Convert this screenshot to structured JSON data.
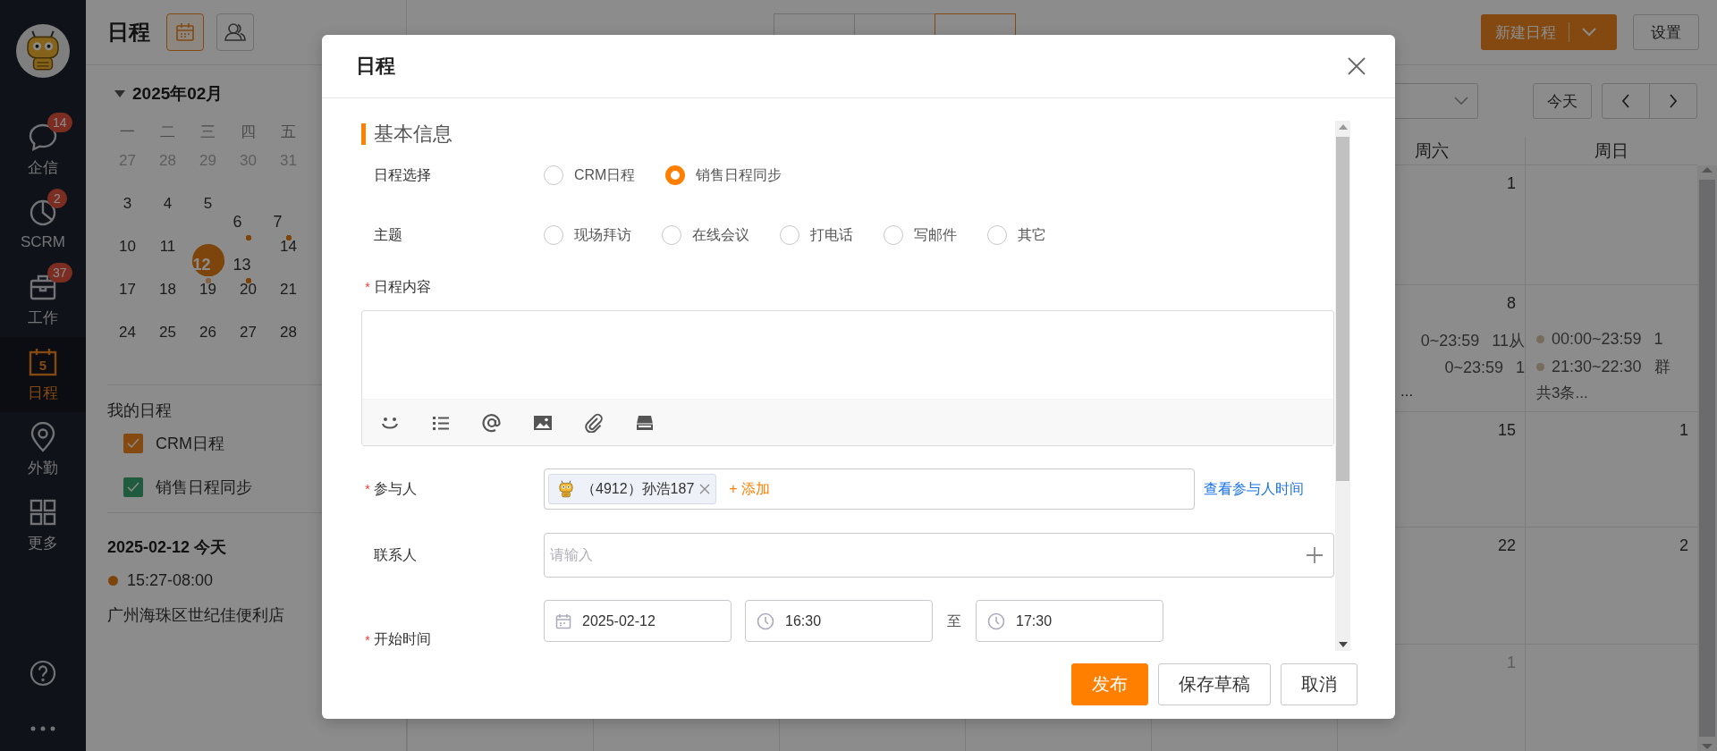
{
  "nav": {
    "items": [
      {
        "label": "企信",
        "badge": "14",
        "selected": false
      },
      {
        "label": "SCRM",
        "badge": "2",
        "selected": false
      },
      {
        "label": "工作",
        "badge": "37",
        "selected": false
      },
      {
        "label": "日程",
        "icon_text": "5",
        "selected": true
      },
      {
        "label": "外勤",
        "selected": false
      },
      {
        "label": "更多",
        "selected": false
      }
    ]
  },
  "panel": {
    "title": "日程",
    "view_buttons": [
      {
        "selected": true
      },
      {
        "selected": false
      }
    ]
  },
  "mini_calendar": {
    "month": "2025年02月",
    "expanded": true,
    "weekdays": [
      "一",
      "二",
      "三",
      "四",
      "五"
    ],
    "weeks": [
      [
        {
          "day": "27",
          "muted": true,
          "selected": false,
          "has_event": false
        },
        {
          "day": "28",
          "muted": true,
          "selected": false,
          "has_event": false
        },
        {
          "day": "29",
          "muted": true,
          "selected": false,
          "has_event": false
        },
        {
          "day": "30",
          "muted": true,
          "selected": false,
          "has_event": false
        },
        {
          "day": "31",
          "muted": true,
          "selected": false,
          "has_event": false
        }
      ],
      [
        {
          "day": "3",
          "muted": false,
          "selected": false,
          "has_event": false
        },
        {
          "day": "4",
          "muted": false,
          "selected": false,
          "has_event": false
        },
        {
          "day": "5",
          "muted": false,
          "selected": false,
          "has_event": false
        },
        {
          "day": "6",
          "muted": false,
          "selected": false,
          "has_event": true
        },
        {
          "day": "7",
          "muted": false,
          "selected": false,
          "has_event": true
        }
      ],
      [
        {
          "day": "10",
          "muted": false,
          "selected": false,
          "has_event": false
        },
        {
          "day": "11",
          "muted": false,
          "selected": false,
          "has_event": false
        },
        {
          "day": "12",
          "muted": false,
          "selected": true,
          "has_event": true
        },
        {
          "day": "13",
          "muted": false,
          "selected": false,
          "has_event": true
        },
        {
          "day": "14",
          "muted": false,
          "selected": false,
          "has_event": false
        }
      ],
      [
        {
          "day": "17",
          "muted": false,
          "selected": false,
          "has_event": false
        },
        {
          "day": "18",
          "muted": false,
          "selected": false,
          "has_event": false
        },
        {
          "day": "19",
          "muted": false,
          "selected": false,
          "has_event": false
        },
        {
          "day": "20",
          "muted": false,
          "selected": false,
          "has_event": false
        },
        {
          "day": "21",
          "muted": false,
          "selected": false,
          "has_event": false
        }
      ],
      [
        {
          "day": "24",
          "muted": false,
          "selected": false,
          "has_event": false
        },
        {
          "day": "25",
          "muted": false,
          "selected": false,
          "has_event": false
        },
        {
          "day": "26",
          "muted": false,
          "selected": false,
          "has_event": false
        },
        {
          "day": "27",
          "muted": false,
          "selected": false,
          "has_event": false
        },
        {
          "day": "28",
          "muted": false,
          "selected": false,
          "has_event": false
        }
      ]
    ]
  },
  "my_calendars": {
    "title": "我的日程",
    "items": [
      {
        "label": "CRM日程",
        "checked": true,
        "color": "#844a11"
      },
      {
        "label": "销售日程同步",
        "checked": true,
        "color": "#205c3c"
      }
    ]
  },
  "today": {
    "heading": "2025-02-12 今天",
    "events": [
      {
        "time": "15:27-08:00",
        "title": "广州海珠区世纪佳便利店"
      }
    ]
  },
  "toolbar": {
    "view_tabs": [
      {
        "selected": false
      },
      {
        "selected": false
      },
      {
        "selected": true
      }
    ],
    "new_button": "新建日程",
    "settings_button": "设置",
    "today_button": "今天"
  },
  "calendar": {
    "weekdays": [
      "周六",
      "周日"
    ],
    "weeks": [
      {
        "saturday": {
          "date": "1",
          "muted": false
        }
      },
      {
        "saturday": {
          "date": "8",
          "muted": false,
          "events": [
            {
              "time": "0~23:59",
              "title": "11从"
            },
            {
              "time": "0~23:59",
              "title": "1"
            }
          ],
          "more": "..."
        },
        "sunday": {
          "events": [
            {
              "time": "00:00~23:59",
              "title": "1"
            },
            {
              "time": "21:30~22:30",
              "title": "群"
            }
          ],
          "more": "共3条..."
        }
      },
      {
        "saturday": {
          "date": "15",
          "muted": false
        },
        "sunday": {
          "date": "1",
          "muted": false
        }
      },
      {
        "saturday": {
          "date": "22",
          "muted": false
        },
        "sunday": {
          "date": "2",
          "muted": false
        }
      },
      {
        "saturday": {
          "date": "1",
          "muted": true
        }
      }
    ]
  },
  "modal": {
    "title": "日程",
    "section": "基本信息",
    "fields": [
      {
        "kind": "radio",
        "label": "日程选择",
        "options": [
          {
            "label": "CRM日程",
            "selected": false
          },
          {
            "label": "销售日程同步",
            "selected": true
          }
        ]
      },
      {
        "kind": "radio",
        "label": "主题",
        "options": [
          {
            "label": "现场拜访",
            "selected": false
          },
          {
            "label": "在线会议",
            "selected": false
          },
          {
            "label": "打电话",
            "selected": false
          },
          {
            "label": "写邮件",
            "selected": false
          },
          {
            "label": "其它",
            "selected": false
          }
        ]
      },
      {
        "kind": "editor",
        "label": "日程内容",
        "marker": "*"
      },
      {
        "kind": "people",
        "label": "参与人",
        "marker": "*",
        "chips": [
          {
            "label": "（4912）孙浩187"
          }
        ],
        "add": "+ 添加",
        "link": "查看参与人时间"
      },
      {
        "kind": "text",
        "label": "联系人",
        "placeholder": "请输入"
      },
      {
        "kind": "time_range",
        "label": "开始时间",
        "marker": "*",
        "date": "2025-02-12",
        "start": "16:30",
        "separator": "至",
        "end": "17:30"
      }
    ],
    "buttons": [
      {
        "label": "发布",
        "primary": true
      },
      {
        "label": "保存草稿",
        "primary": false
      },
      {
        "label": "取消",
        "primary": false
      }
    ]
  }
}
